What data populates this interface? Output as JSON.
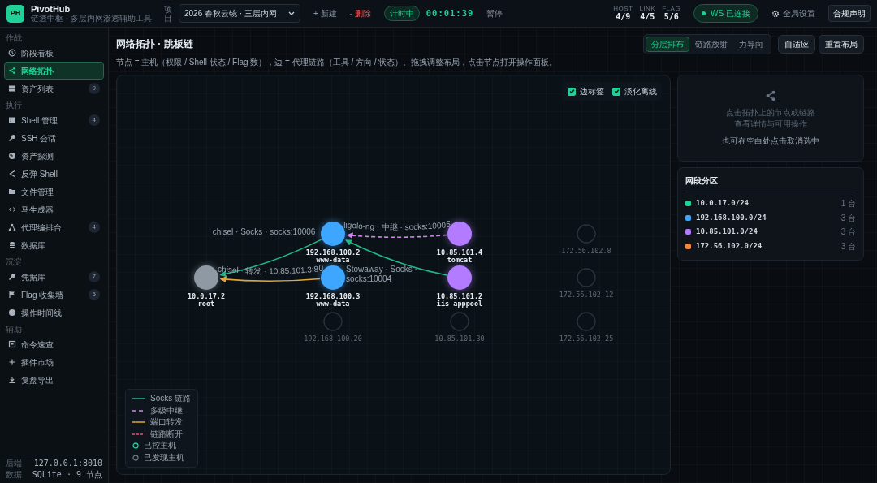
{
  "app": {
    "logo": "PH",
    "name": "PivotHub",
    "subtitle": "链透中枢 · 多层内网渗透辅助工具"
  },
  "project": {
    "label": "项目",
    "value": "2026 春秋云镜 · 三层内网",
    "new": "+ 新建",
    "delete": "- 删除"
  },
  "timer": {
    "state": "计时中",
    "time": "00:01:39",
    "pause": "暂停"
  },
  "stats": [
    {
      "label": "HOST",
      "value": "4/9"
    },
    {
      "label": "LINK",
      "value": "4/5"
    },
    {
      "label": "FLAG",
      "value": "5/6"
    }
  ],
  "ws": {
    "text": "WS 已连接",
    "connected": true
  },
  "settings": "全局设置",
  "compliance": "合规声明",
  "sidebar": {
    "sections": [
      {
        "title": "作战",
        "items": [
          {
            "label": "阶段看板",
            "selected": false
          },
          {
            "label": "网络拓扑",
            "selected": true
          },
          {
            "label": "资产列表",
            "count": "9",
            "selected": false
          }
        ]
      },
      {
        "title": "执行",
        "items": [
          {
            "label": "Shell 管理",
            "count": "4",
            "selected": false
          },
          {
            "label": "SSH 会话",
            "selected": false
          },
          {
            "label": "资产探测",
            "selected": false
          },
          {
            "label": "反弹 Shell",
            "selected": false
          },
          {
            "label": "文件管理",
            "selected": false
          },
          {
            "label": "马生成器",
            "selected": false
          },
          {
            "label": "代理编排台",
            "count": "4",
            "selected": false
          },
          {
            "label": "数据库",
            "selected": false
          }
        ]
      },
      {
        "title": "沉淀",
        "items": [
          {
            "label": "凭据库",
            "count": "7",
            "selected": false
          },
          {
            "label": "Flag 收集墙",
            "count": "5",
            "selected": false
          },
          {
            "label": "操作时间线",
            "selected": false
          }
        ]
      },
      {
        "title": "辅助",
        "items": [
          {
            "label": "命令速查",
            "selected": false
          },
          {
            "label": "插件市场",
            "selected": false
          },
          {
            "label": "复盘导出",
            "selected": false
          }
        ]
      }
    ],
    "footer": [
      {
        "label": "后端",
        "value": "127.0.0.1:8010"
      },
      {
        "label": "数据",
        "value": "SQLite · 9 节点"
      }
    ]
  },
  "page": {
    "title": "网络拓扑 · 跳板链",
    "description": "节点 = 主机（权限 / Shell 状态 / Flag 数），边 = 代理链路（工具 / 方向 / 状态）。拖拽调整布局，点击节点打开操作面板。"
  },
  "layouts": [
    {
      "label": "分层排布",
      "selected": true
    },
    {
      "label": "链路放射",
      "selected": false
    },
    {
      "label": "力导向",
      "selected": false
    }
  ],
  "actions": [
    "自适应",
    "重置布局"
  ],
  "options": [
    {
      "label": "边标签",
      "checked": true
    },
    {
      "label": "淡化离线",
      "checked": true
    }
  ],
  "layers": [
    {
      "hosts": [
        {
          "ip": "10.0.17.2",
          "user": "root",
          "controlled": true,
          "color": "#8e99a4"
        }
      ]
    },
    {
      "hosts": [
        {
          "ip": "192.168.100.2",
          "user": "www-data",
          "controlled": true,
          "color": "#3ea6ff",
          "link": {
            "kind": "socks",
            "label": "chisel · Socks · socks:10006"
          }
        },
        {
          "ip": "192.168.100.3",
          "user": "www-data",
          "controlled": true,
          "color": "#3ea6ff",
          "link": {
            "kind": "forward",
            "label": "chisel · 转发 · 10.85.101.3:80"
          }
        },
        {
          "ip": "192.168.100.20",
          "controlled": false
        }
      ]
    },
    {
      "hosts": [
        {
          "ip": "10.85.101.4",
          "user": "tomcat",
          "controlled": true,
          "color": "#b37bff",
          "link": {
            "kind": "relay",
            "label": "ligolo-ng · 中继 · socks:10005"
          }
        },
        {
          "ip": "10.85.101.2",
          "user": "iis apppool",
          "controlled": true,
          "color": "#b37bff",
          "link": {
            "kind": "socks",
            "label": "Stowaway · Socks · socks:10004"
          }
        },
        {
          "ip": "10.85.101.30",
          "controlled": false
        }
      ]
    },
    {
      "hosts": [
        {
          "ip": "172.56.102.8",
          "controlled": false
        },
        {
          "ip": "172.56.102.12",
          "controlled": false
        },
        {
          "ip": "172.56.102.25",
          "controlled": false
        }
      ]
    }
  ],
  "legend": [
    {
      "kind": "socks",
      "label": "Socks 链路"
    },
    {
      "kind": "relay",
      "label": "多级中继"
    },
    {
      "kind": "forward",
      "label": "端口转发"
    },
    {
      "kind": "broken",
      "label": "链路断开"
    },
    {
      "kind": "controlled",
      "label": "已控主机"
    },
    {
      "kind": "discovered",
      "label": "已发现主机"
    }
  ],
  "hint": {
    "lines": [
      "点击拓扑上的节点或链路",
      "查看详情与可用操作"
    ],
    "note": "也可在空白处点击取消选中"
  },
  "segments": {
    "title": "网段分区",
    "items": [
      {
        "cidr": "10.0.17.0/24",
        "count": "1 台",
        "color": "#1fd196"
      },
      {
        "cidr": "192.168.100.0/24",
        "count": "3 台",
        "color": "#3ea6ff"
      },
      {
        "cidr": "10.85.101.0/24",
        "count": "3 台",
        "color": "#b37bff"
      },
      {
        "cidr": "172.56.102.0/24",
        "count": "3 台",
        "color": "#f0883e"
      }
    ]
  }
}
